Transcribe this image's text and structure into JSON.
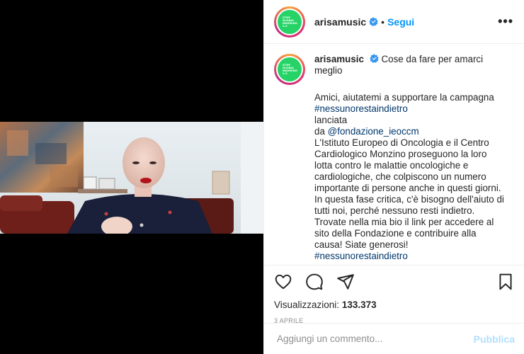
{
  "post": {
    "username": "arisamusic",
    "follow_label": "Segui",
    "separator": "•",
    "more_label": "•••",
    "avatar_text": [
      "STOP",
      "GLOBAL",
      "WARMING",
      "2.0"
    ]
  },
  "caption": {
    "title_line": "Cose da fare per amarci meglio",
    "line1": "Amici, aiutatemi a supportare la campagna",
    "hashtag1": "#nessunorestaindietro",
    "line2a": "lanciata",
    "line2b": "da",
    "mention": "@fondazione_ieoccm",
    "body": "L'Istituto Europeo di Oncologia e il Centro Cardiologico Monzino proseguono la loro lotta contro le malattie oncologiche e cardiologiche, che colpiscono un numero importante di persone anche in questi giorni. In questa fase critica, c'è bisogno dell'aiuto di tutti noi, perché nessuno resti indietro.",
    "closing": "Trovate nella mia bio il link per accedere al sito della Fondazione e contribuire alla causa! Siate generosi!",
    "hashtag2": "#nessunorestaindietro"
  },
  "stats": {
    "views_label": "Visualizzazioni:",
    "views_value": "133.373",
    "date": "3 APRILE"
  },
  "comment": {
    "placeholder": "Aggiungi un commento...",
    "publish_label": "Pubblica"
  },
  "icons": {
    "verified": "verified-badge-icon",
    "like": "heart-icon",
    "comment": "comment-bubble-icon",
    "share": "paper-plane-icon",
    "save": "bookmark-icon"
  },
  "colors": {
    "link": "#0095f6",
    "hashtag": "#00376b",
    "publish_disabled": "#b2dffc",
    "avatar_bg": "#25d366"
  }
}
